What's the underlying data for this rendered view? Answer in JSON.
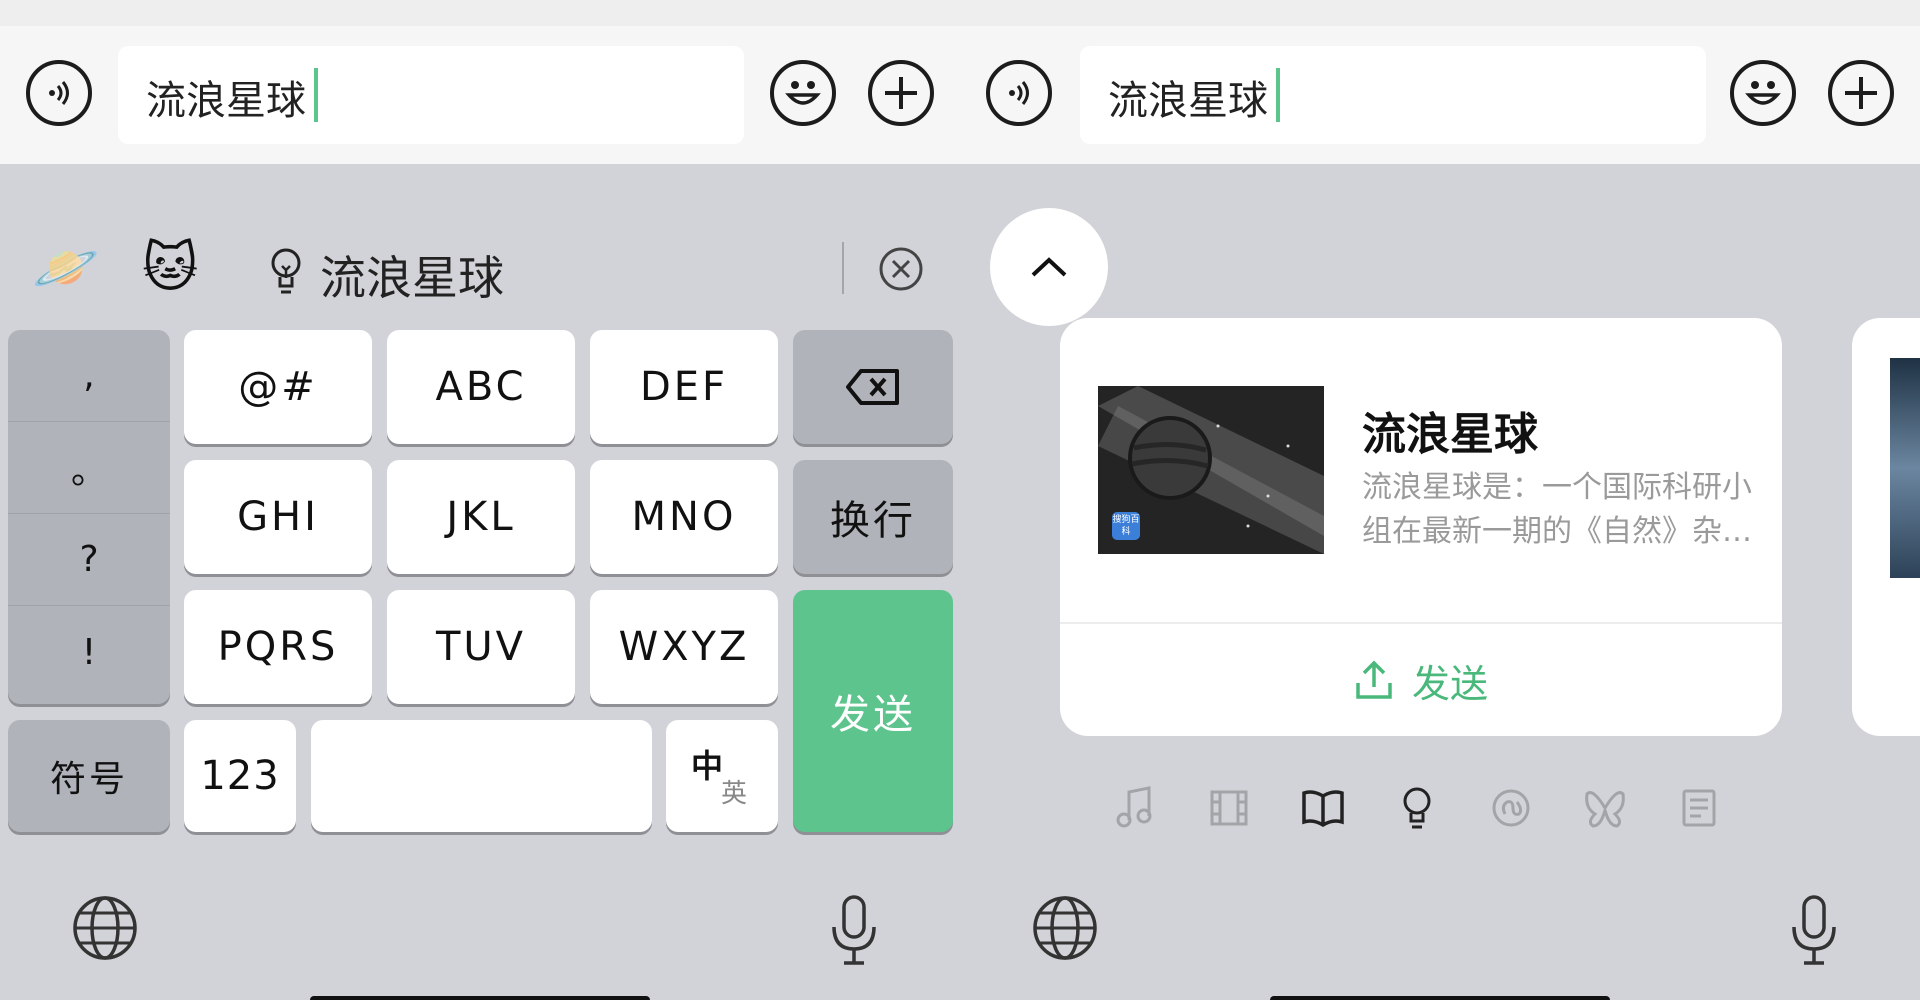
{
  "left": {
    "input": {
      "value": "流浪星球"
    },
    "suggestions": {
      "emoji_1": "🪐",
      "emoji_2": "🐱",
      "text": "流浪星球"
    },
    "keyboard": {
      "punctuation": [
        ",",
        "。",
        "?",
        "!"
      ],
      "rows": [
        [
          "@#",
          "ABC",
          "DEF"
        ],
        [
          "GHI",
          "JKL",
          "MNO"
        ],
        [
          "PQRS",
          "TUV",
          "WXYZ"
        ]
      ],
      "newline": "换行",
      "send": "发送",
      "symbols": "符号",
      "numbers": "123",
      "lang_cn": "中",
      "lang_en": "英"
    }
  },
  "right": {
    "input": {
      "value": "流浪星球"
    },
    "card": {
      "title": "流浪星球",
      "description": "流浪星球是：一个国际科研小组在最新一期的《自然》杂…",
      "badge": "搜狗百科",
      "send": "发送"
    },
    "tab_icons": [
      "music-icon",
      "film-icon",
      "book-icon",
      "lightbulb-icon",
      "mini-program-icon",
      "butterfly-icon",
      "document-icon"
    ]
  },
  "colors": {
    "accent_green": "#5ec48e",
    "send_text_green": "#49b87a"
  }
}
